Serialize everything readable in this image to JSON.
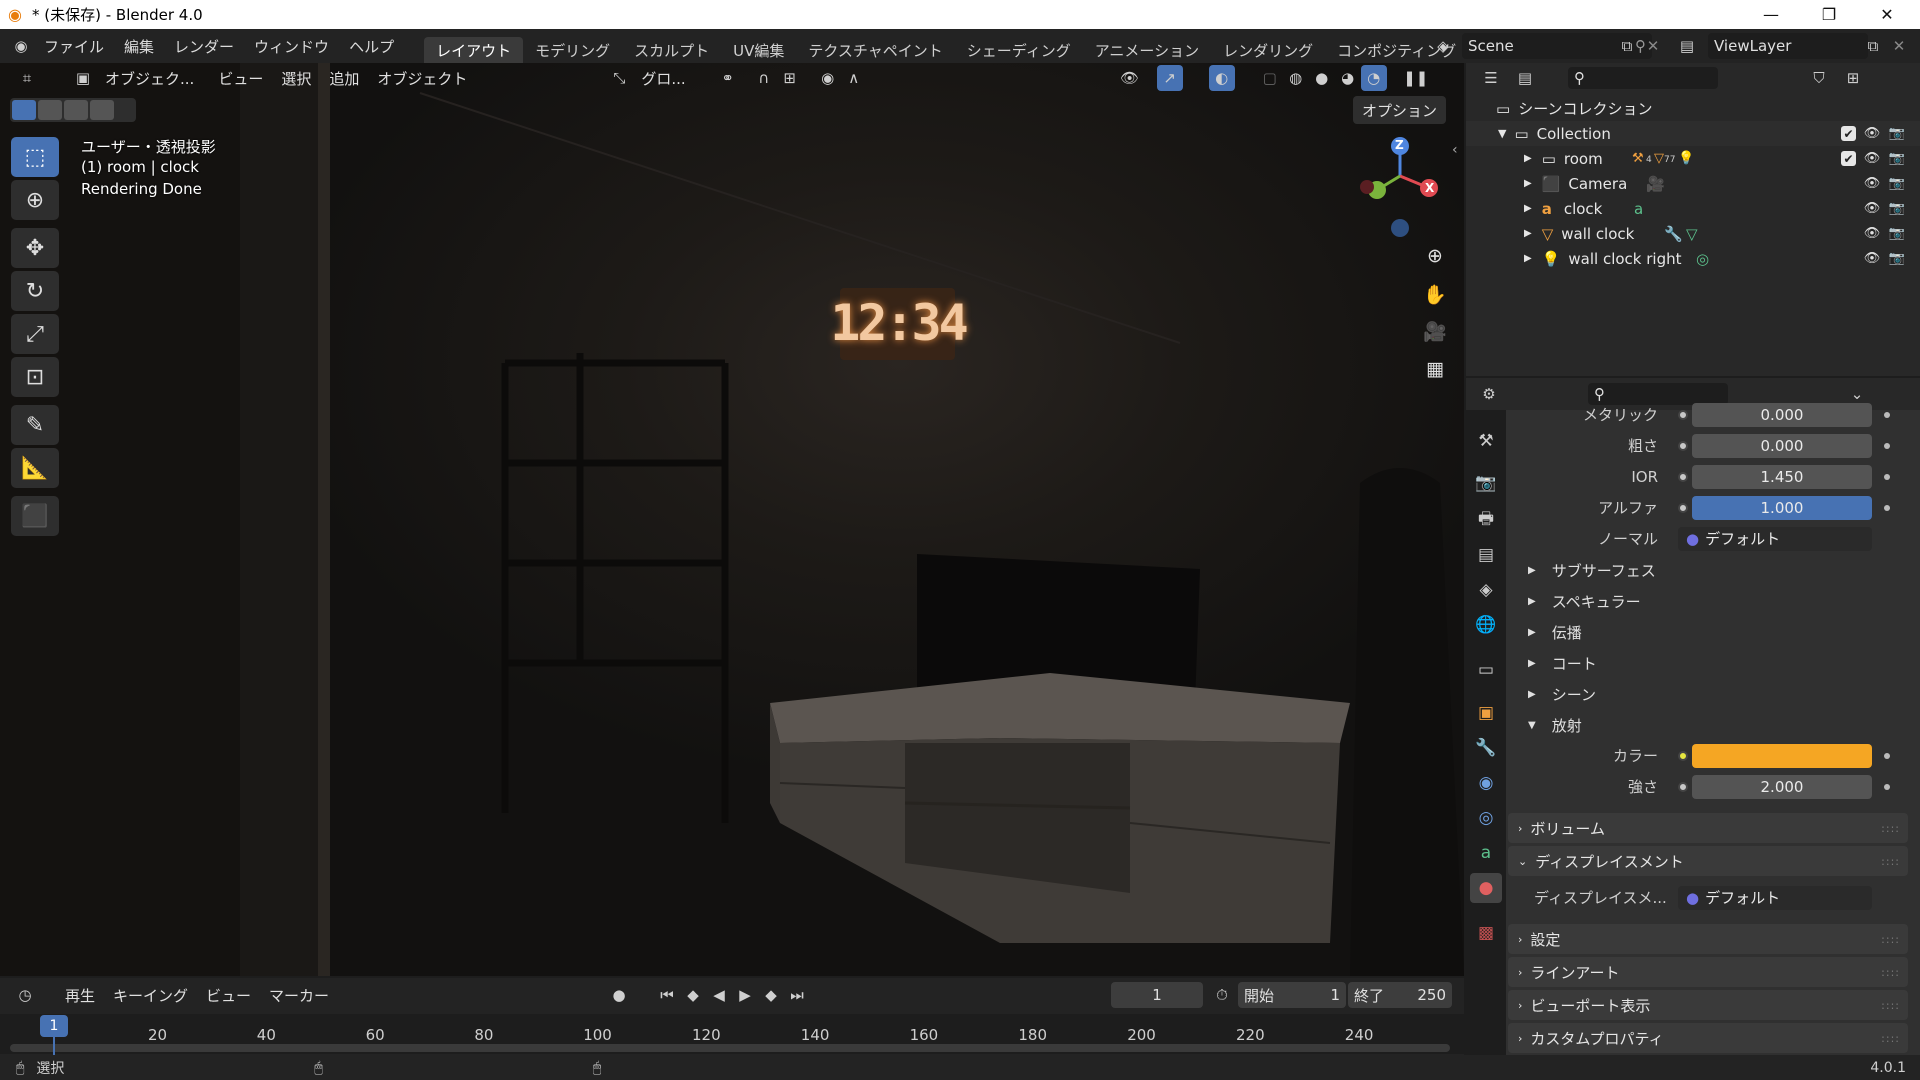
{
  "window": {
    "title": "* (未保存) - Blender 4.0"
  },
  "menu": {
    "file": "ファイル",
    "edit": "編集",
    "render": "レンダー",
    "window": "ウィンドウ",
    "help": "ヘルプ"
  },
  "workspaces": [
    "レイアウト",
    "モデリング",
    "スカルプト",
    "UV編集",
    "テクスチャペイント",
    "シェーディング",
    "アニメーション",
    "レンダリング",
    "コンポジティング"
  ],
  "scene": {
    "name": "Scene",
    "view_layer": "ViewLayer"
  },
  "viewport_header": {
    "mode": "オブジェク...",
    "view": "ビュー",
    "select": "選択",
    "add": "追加",
    "object": "オブジェクト",
    "transform": "グロ...",
    "options": "オプション"
  },
  "viewport_info": {
    "line1": "ユーザー・透視投影",
    "line2": "(1) room | clock",
    "line3": "Rendering Done"
  },
  "clock_display": "12:34",
  "gizmo": {
    "z": "Z",
    "x": "X"
  },
  "outliner": {
    "root": "シーンコレクション",
    "collection": "Collection",
    "items": [
      {
        "name": "room",
        "icon": "mesh-icon",
        "badge": "4",
        "badge2": "77"
      },
      {
        "name": "Camera",
        "icon": "camera-icon"
      },
      {
        "name": "clock",
        "icon": "text-icon"
      },
      {
        "name": "wall clock",
        "icon": "mesh-icon"
      },
      {
        "name": "wall clock right",
        "icon": "light-icon"
      }
    ]
  },
  "properties": {
    "rows": [
      {
        "label": "メタリック",
        "value": "0.000"
      },
      {
        "label": "粗さ",
        "value": "0.000"
      },
      {
        "label": "IOR",
        "value": "1.450"
      },
      {
        "label": "アルファ",
        "value": "1.000"
      }
    ],
    "normal_label": "ノーマル",
    "normal_value": "デフォルト",
    "subsections": [
      "サブサーフェス",
      "スペキュラー",
      "伝播",
      "コート",
      "シーン"
    ],
    "emission": "放射",
    "color_label": "カラー",
    "strength_label": "強さ",
    "strength_value": "2.000",
    "emission_color": "#f5a623",
    "alpha_color": "#4772b3",
    "panels": {
      "volume": "ボリューム",
      "displacement": "ディスプレイスメント",
      "displacement_field": "ディスプレイスメ...",
      "displacement_value": "デフォルト",
      "settings": "設定",
      "lineart": "ラインアート",
      "viewport_display": "ビューポート表示",
      "custom_props": "カスタムプロパティ"
    }
  },
  "timeline": {
    "playback": "再生",
    "keying": "キーイング",
    "view": "ビュー",
    "marker": "マーカー",
    "current_frame": "1",
    "start_label": "開始",
    "start": "1",
    "end_label": "終了",
    "end": "250",
    "ticks": [
      "20",
      "40",
      "60",
      "80",
      "100",
      "120",
      "140",
      "160",
      "180",
      "200",
      "220",
      "240"
    ],
    "cursor": "1"
  },
  "status": {
    "select": "選択",
    "version": "4.0.1"
  }
}
